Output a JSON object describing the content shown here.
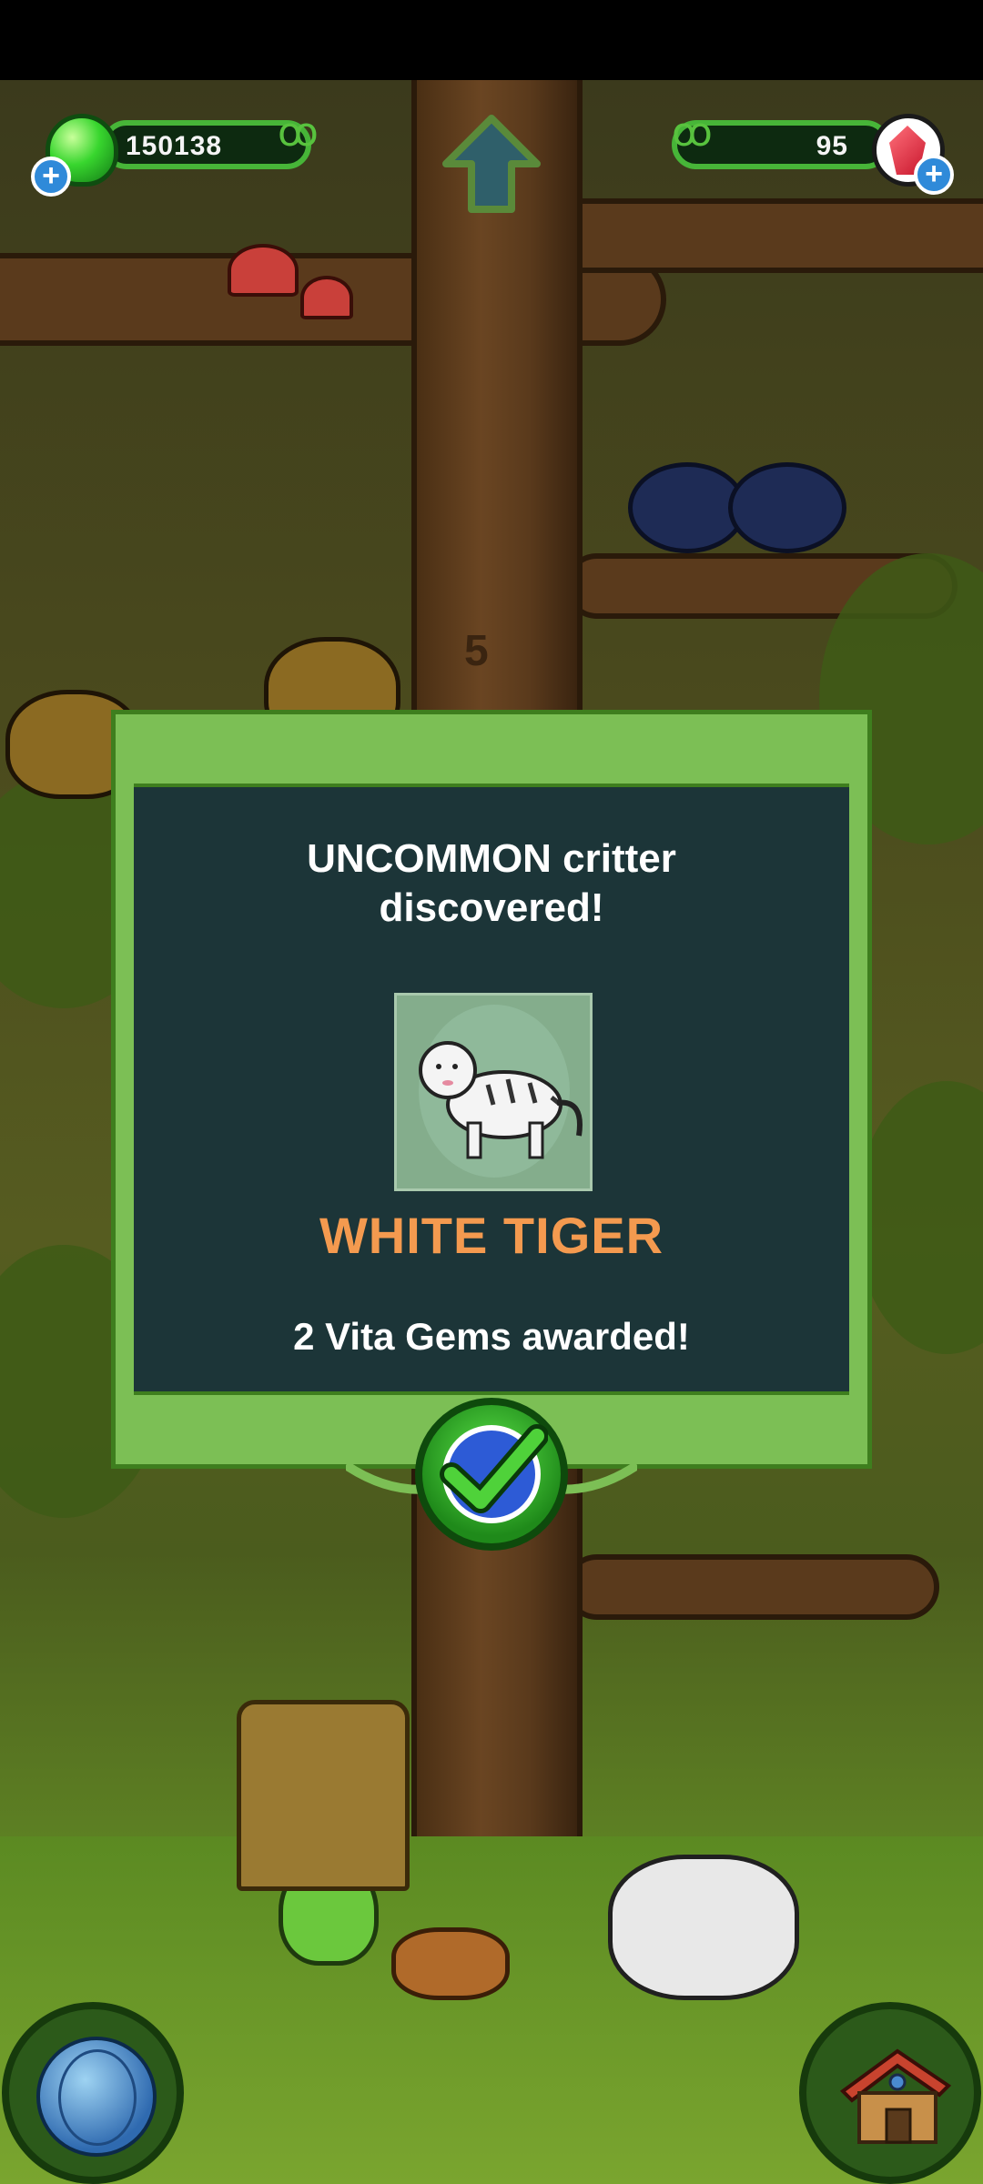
{
  "hud": {
    "green_gems": "150138",
    "red_gems": "95",
    "add_symbol": "+"
  },
  "scene": {
    "trunk_marker": "5"
  },
  "modal": {
    "headline_line1": "UNCOMMON critter",
    "headline_line2": "discovered!",
    "critter_name": "WHITE TIGER",
    "reward_text": "2 Vita Gems awarded!",
    "critter_name_color": "#f49a4f",
    "panel_color": "#1c3538",
    "frame_color": "#7cbf55"
  },
  "icons": {
    "green_currency": "green-gem-icon",
    "red_currency": "red-crystal-icon",
    "home": "up-arrow-icon",
    "confirm": "checkmark-icon",
    "world": "globe-icon",
    "habitat": "house-icon"
  }
}
